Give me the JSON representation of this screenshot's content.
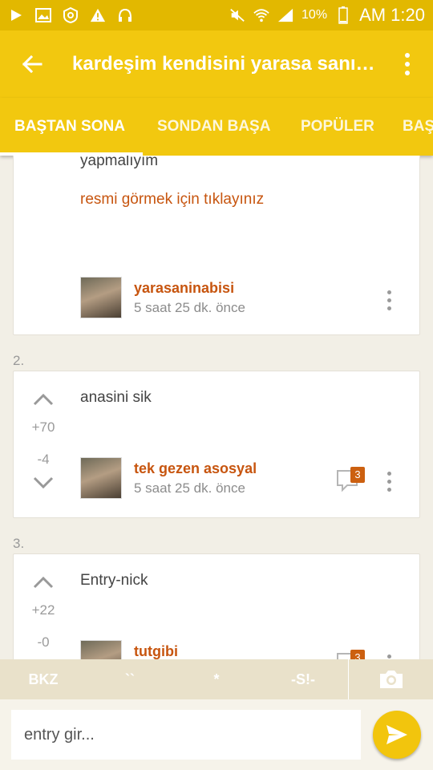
{
  "status_bar": {
    "battery": "10%",
    "time": "AM 1:20",
    "icons": [
      "play-icon",
      "image-icon",
      "shield-icon",
      "warning-icon",
      "headphones-icon",
      "mute-icon",
      "wifi-icon",
      "signal-icon",
      "battery-icon"
    ]
  },
  "app_bar": {
    "title": "kardeşim kendisini yarasa sanı…"
  },
  "tabs": [
    {
      "label": "BAŞTAN SONA"
    },
    {
      "label": "SONDAN BAŞA"
    },
    {
      "label": "POPÜLER"
    },
    {
      "label": "BAŞ"
    }
  ],
  "entries": [
    {
      "text": "yapmalıyım",
      "link": "resmi görmek için tıklayınız",
      "author": "yarasaninabisi",
      "time": "5 saat 25 dk. önce"
    },
    {
      "index": "2.",
      "text": "anasini sik",
      "up": "+70",
      "down": "-4",
      "author": "tek gezen asosyal",
      "time": "5 saat 25 dk. önce",
      "comments": "3"
    },
    {
      "index": "3.",
      "text": "Entry-nick",
      "up": "+22",
      "down": "-0",
      "author": "tutgibi",
      "comments": "3"
    }
  ],
  "format_bar": {
    "bkz": "BKZ",
    "backticks": "``",
    "star": "*",
    "spoiler": "-S!-"
  },
  "input": {
    "placeholder": "entry gir..."
  },
  "colors": {
    "accent": "#f2c80f",
    "link": "#c7550f"
  }
}
